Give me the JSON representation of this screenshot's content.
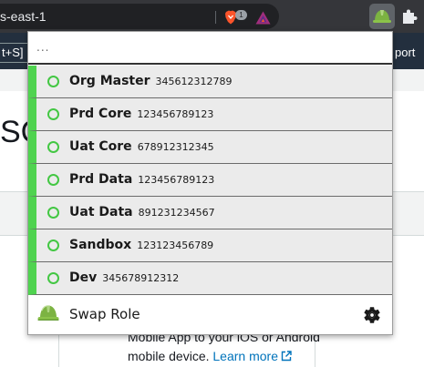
{
  "browser": {
    "address_text": "s-east-1",
    "brave_shields_count": "1",
    "colors": {
      "toolbar": "#35363a",
      "omnibox": "#202124"
    }
  },
  "page": {
    "shortcut_text": "t+S]",
    "support_text": "port",
    "big_text": "SC",
    "card_line1": "Mobile App to your iOS or Android",
    "card_line2_prefix": "mobile device.",
    "learn_more": "Learn more"
  },
  "popup": {
    "search": {
      "value": "",
      "placeholder": "..."
    },
    "roles": [
      {
        "name": "Org Master",
        "account": "345612312789"
      },
      {
        "name": "Prd Core",
        "account": "123456789123"
      },
      {
        "name": "Uat Core",
        "account": "678912312345"
      },
      {
        "name": "Prd Data",
        "account": "123456789123"
      },
      {
        "name": "Uat Data",
        "account": "891231234567"
      },
      {
        "name": "Sandbox",
        "account": "123123456789"
      },
      {
        "name": "Dev",
        "account": "345678912312"
      }
    ],
    "footer": {
      "title": "Swap Role",
      "icon": "hard-hat-icon",
      "settings_icon": "gear-icon"
    },
    "colors": {
      "role_accent": "#4fd34f",
      "role_background": "#ebebeb"
    }
  }
}
